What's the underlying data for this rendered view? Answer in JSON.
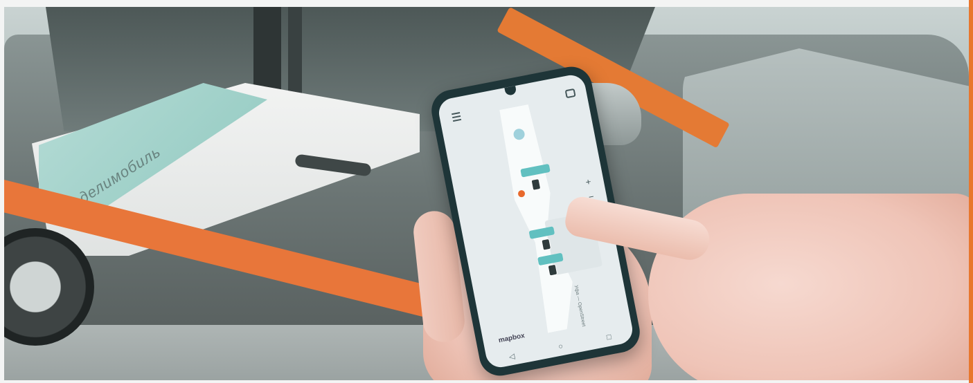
{
  "scene": "photo",
  "colors": {
    "frame_accent": "#e8772e",
    "car_stripe": "#e47a34",
    "map_label": "#61c0c0",
    "pin": "#e8692c"
  },
  "phone": {
    "map_labels": [
      "",
      "",
      ""
    ],
    "zoom_in_label": "+",
    "zoom_out_label": "−",
    "attribution_logo": "mapbox",
    "attribution_text": "Уфа — OpenStreet",
    "nav": {
      "back_icon": "back-triangle-icon",
      "home_icon": "home-circle-icon",
      "recents_icon": "recents-square-icon",
      "back_glyph": "◁",
      "home_glyph": "○",
      "recents_glyph": "□"
    },
    "menu_icon": "menu-icon",
    "chat_icon": "chat-icon"
  },
  "car": {
    "logo_text": "делимобиль"
  }
}
